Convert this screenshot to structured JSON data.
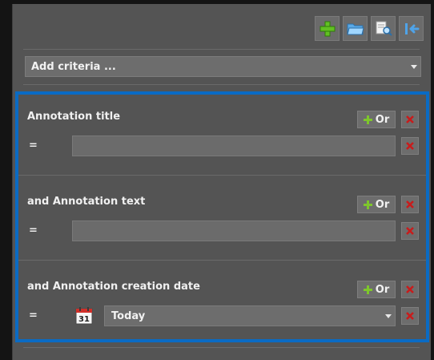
{
  "toolbar": {
    "buttons": [
      {
        "name": "add-icon",
        "color": "#6fcf2b"
      },
      {
        "name": "open-folder-icon",
        "color": "#7fc7ff"
      },
      {
        "name": "find-document-icon",
        "color": "#e8e8e8"
      },
      {
        "name": "collapse-left-icon",
        "color": "#7fc7ff"
      }
    ]
  },
  "add_criteria": {
    "label": "Add criteria ..."
  },
  "criteria": [
    {
      "title": "Annotation title",
      "operator": "=",
      "value": "",
      "or_label": "Or"
    },
    {
      "title": "and Annotation text",
      "operator": "=",
      "value": "",
      "or_label": "Or"
    },
    {
      "title": "and Annotation creation date",
      "operator": "=",
      "value": "Today",
      "or_label": "Or",
      "calendar_day": "31"
    }
  ],
  "colors": {
    "panel": "#545454",
    "highlight_border": "#0a6bc4",
    "delete": "#c81c1c",
    "plus": "#7ec62c"
  }
}
